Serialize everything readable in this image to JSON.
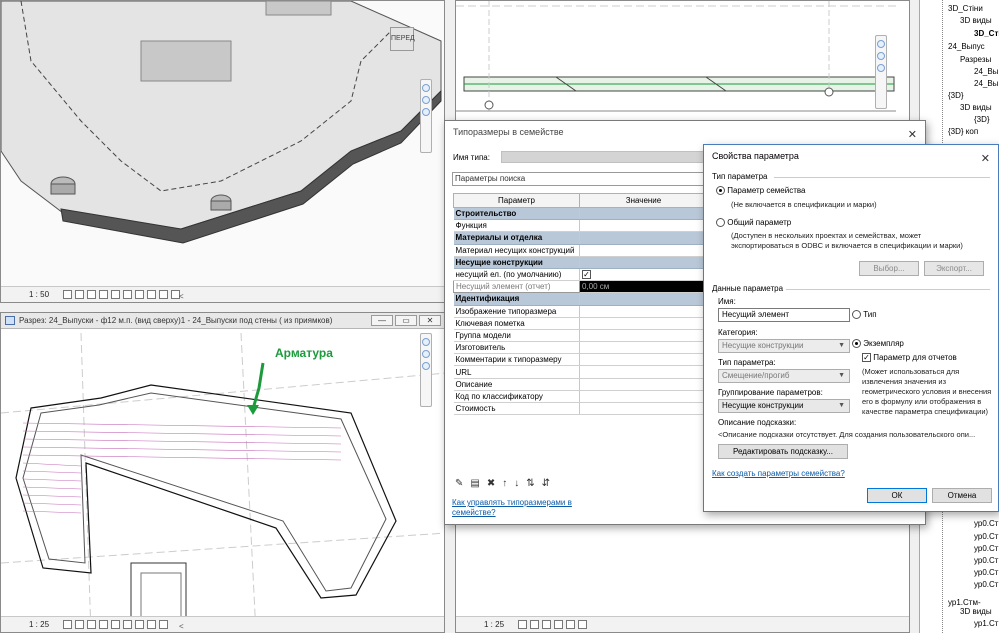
{
  "viewport_3d": {
    "scale": "1 : 50",
    "cube_label": "ПЕРЕД"
  },
  "viewport_plan": {
    "title": "Разрез: 24_Выпуски - ф12 м.п. (вид сверху)1 - 24_Выпуски под стены ( из приямков)",
    "scale": "1 : 25",
    "annotation": "Арматура"
  },
  "viewport_section": {
    "scale": "1 : 25"
  },
  "window_buttons": {
    "minimize": "—",
    "restore": "▭",
    "close": "✕"
  },
  "project_browser": {
    "items": [
      {
        "label": "3D_Стіни",
        "bold": false
      },
      {
        "label": "3D виды",
        "bold": false
      },
      {
        "label": "3D_Сті",
        "bold": true
      },
      {
        "label": "24_Выпус",
        "bold": false
      },
      {
        "label": "Разрезы",
        "bold": false
      },
      {
        "label": "24_Вы",
        "bold": false
      },
      {
        "label": "24_Вы",
        "bold": false
      },
      {
        "label": "{3D}",
        "bold": false
      },
      {
        "label": "3D виды",
        "bold": false
      },
      {
        "label": "{3D}",
        "bold": false
      },
      {
        "label": "{3D} коп",
        "bold": false
      },
      {
        "label": "ур0.Ст",
        "bold": false
      },
      {
        "label": "ур0.Ст",
        "bold": false
      },
      {
        "label": "ур0.Ст",
        "bold": false
      },
      {
        "label": "ур0.Ст",
        "bold": false
      },
      {
        "label": "ур0.Ст",
        "bold": false
      },
      {
        "label": "ур0.Ст",
        "bold": false
      },
      {
        "label": "ур1.Стм-",
        "bold": false
      },
      {
        "label": "3D виды",
        "bold": false
      },
      {
        "label": "ур1.Ст",
        "bold": false
      }
    ]
  },
  "types_dialog": {
    "title": "Типоразмеры в семействе",
    "type_name_label": "Имя типа:",
    "search_placeholder": "Параметры поиска",
    "col_param": "Параметр",
    "col_value": "Значение",
    "rows": [
      {
        "kind": "group",
        "name": "Строительство",
        "value": ""
      },
      {
        "kind": "row",
        "name": "Функция",
        "value": ""
      },
      {
        "kind": "group",
        "name": "Материалы и отделка",
        "value": ""
      },
      {
        "kind": "row",
        "name": "Материал несущих конструкций",
        "value": ""
      },
      {
        "kind": "group",
        "name": "Несущие конструкции",
        "value": ""
      },
      {
        "kind": "check",
        "name": "несущий ел. (по умолчанию)",
        "value": "✓"
      },
      {
        "kind": "hl",
        "name": "Несущий элемент (отчет)",
        "value": "0,00 см"
      },
      {
        "kind": "group",
        "name": "Идентификация",
        "value": ""
      },
      {
        "kind": "row",
        "name": "Изображение типоразмера",
        "value": ""
      },
      {
        "kind": "row",
        "name": "Ключевая пометка",
        "value": ""
      },
      {
        "kind": "row",
        "name": "Группа модели",
        "value": ""
      },
      {
        "kind": "row",
        "name": "Изготовитель",
        "value": ""
      },
      {
        "kind": "row",
        "name": "Комментарии к типоразмеру",
        "value": ""
      },
      {
        "kind": "row",
        "name": "URL",
        "value": ""
      },
      {
        "kind": "row",
        "name": "Описание",
        "value": ""
      },
      {
        "kind": "row",
        "name": "Код по классификатору",
        "value": ""
      },
      {
        "kind": "row",
        "name": "Стоимость",
        "value": ""
      }
    ],
    "link": "Как управлять типоразмерами в семействе?"
  },
  "param_dialog": {
    "title": "Свойства параметра",
    "param_type_group": "Тип параметра",
    "family_param": "Параметр семейства",
    "family_param_note": "(Не включается в спецификации и марки)",
    "shared_param": "Общий параметр",
    "shared_param_note": "(Доступен в нескольких проектах и семействах, может экспортироваться в ODBC и включается в спецификации и марки)",
    "select_button": "Выбор...",
    "export_button": "Экспорт...",
    "data_group": "Данные параметра",
    "name_label": "Имя:",
    "name_value": "Несущий элемент",
    "type_option": "Тип",
    "category_label": "Категория:",
    "category_value": "Несущие конструкции",
    "instance_option": "Экземпляр",
    "report_param": "Параметр для отчетов",
    "param_type_label": "Тип параметра:",
    "param_type_value": "Смещение/прогиб",
    "report_note": "(Может использоваться для извлечения значения из геометрического условия и внесения его в формулу или отображения в качестве параметра спецификации)",
    "grouping_label": "Группирование параметров:",
    "grouping_value": "Несущие конструкции",
    "tooltip_label": "Описание подсказки:",
    "tooltip_value": "<Описание подсказки отсутствует. Для создания пользовательского опи...",
    "edit_tooltip_button": "Редактировать подсказку...",
    "create_link": "Как создать параметры семейства?",
    "ok": "ОК",
    "cancel": "Отмена"
  }
}
